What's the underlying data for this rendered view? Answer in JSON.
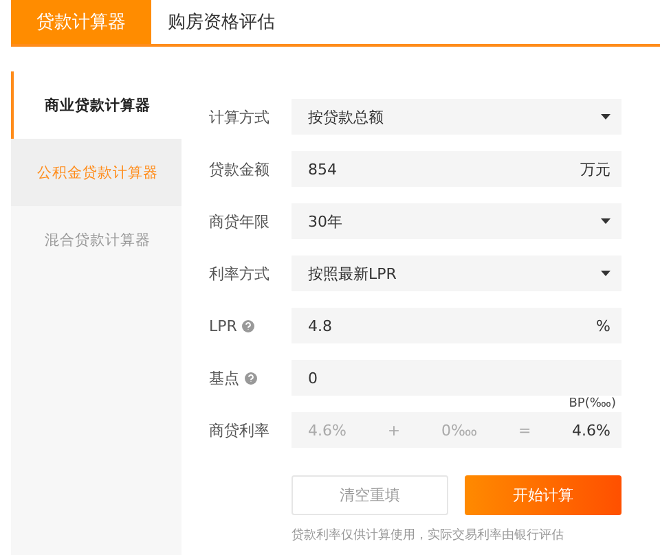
{
  "tabs": [
    {
      "label": "贷款计算器",
      "selected": true
    },
    {
      "label": "购房资格评估",
      "selected": false
    }
  ],
  "sidebar": {
    "items": [
      {
        "label": "商业贷款计算器",
        "selected": true,
        "hovered": false
      },
      {
        "label": "公积金贷款计算器",
        "selected": false,
        "hovered": true
      },
      {
        "label": "混合贷款计算器",
        "selected": false,
        "hovered": false
      }
    ]
  },
  "form": {
    "fields": [
      {
        "kind": "select",
        "label": "计算方式",
        "value": "按贷款总额"
      },
      {
        "kind": "input",
        "label": "贷款金额",
        "value": "854",
        "unit": "万元"
      },
      {
        "kind": "select",
        "label": "商贷年限",
        "value": "30年"
      },
      {
        "kind": "select",
        "label": "利率方式",
        "value": "按照最新LPR"
      },
      {
        "kind": "input",
        "label": "LPR",
        "value": "4.8",
        "unit": "%",
        "help": true
      },
      {
        "kind": "input",
        "label": "基点",
        "value": "0",
        "help": true
      }
    ],
    "bp_caption": "BP(‱)",
    "rate": {
      "label": "商贷利率",
      "base": "4.6%",
      "plus": "+",
      "points": "0‱",
      "equals": "=",
      "result": "4.6%"
    },
    "buttons": {
      "clear": "清空重填",
      "calculate": "开始计算"
    },
    "note": "贷款利率仅供计算使用，实际交易利率由银行评估"
  }
}
